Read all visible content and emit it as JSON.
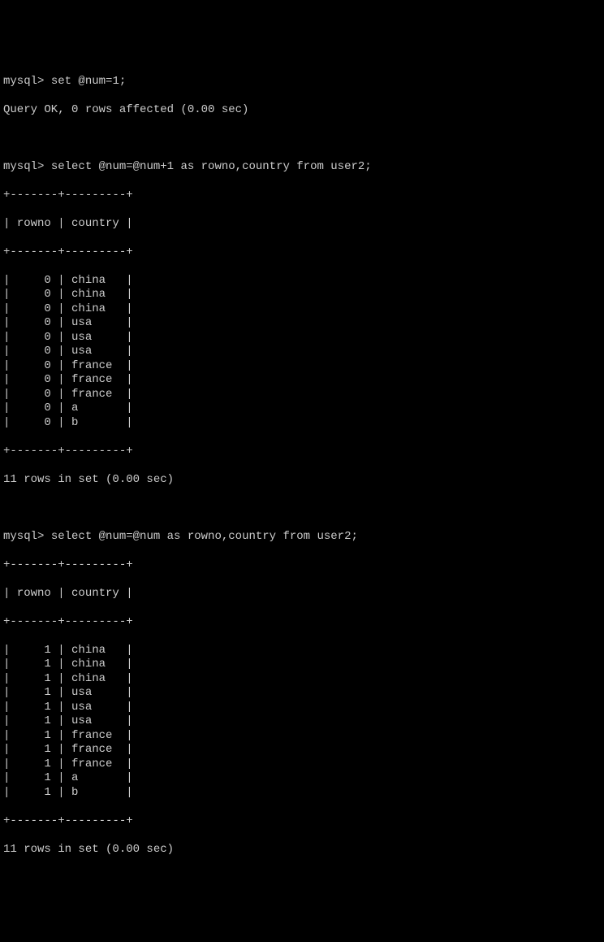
{
  "prompt": "mysql>",
  "commands": {
    "set_num": "set @num=1;",
    "set_num_result": "Query OK, 0 rows affected (0.00 sec)",
    "select1": "select @num=@num+1 as rowno,country from user2;",
    "select2": "select @num=@num as rowno,country from user2;"
  },
  "table1": {
    "border_top": "+-------+---------+",
    "header": "| rowno | country |",
    "border_mid": "+-------+---------+",
    "rows": [
      {
        "rowno": "0",
        "country": "china"
      },
      {
        "rowno": "0",
        "country": "china"
      },
      {
        "rowno": "0",
        "country": "china"
      },
      {
        "rowno": "0",
        "country": "usa"
      },
      {
        "rowno": "0",
        "country": "usa"
      },
      {
        "rowno": "0",
        "country": "usa"
      },
      {
        "rowno": "0",
        "country": "france"
      },
      {
        "rowno": "0",
        "country": "france"
      },
      {
        "rowno": "0",
        "country": "france"
      },
      {
        "rowno": "0",
        "country": "a"
      },
      {
        "rowno": "0",
        "country": "b"
      }
    ],
    "border_bot": "+-------+---------+",
    "summary": "11 rows in set (0.00 sec)"
  },
  "table2": {
    "border_top": "+-------+---------+",
    "header": "| rowno | country |",
    "border_mid": "+-------+---------+",
    "rows": [
      {
        "rowno": "1",
        "country": "china"
      },
      {
        "rowno": "1",
        "country": "china"
      },
      {
        "rowno": "1",
        "country": "china"
      },
      {
        "rowno": "1",
        "country": "usa"
      },
      {
        "rowno": "1",
        "country": "usa"
      },
      {
        "rowno": "1",
        "country": "usa"
      },
      {
        "rowno": "1",
        "country": "france"
      },
      {
        "rowno": "1",
        "country": "france"
      },
      {
        "rowno": "1",
        "country": "france"
      },
      {
        "rowno": "1",
        "country": "a"
      },
      {
        "rowno": "1",
        "country": "b"
      }
    ],
    "border_bot": "+-------+---------+",
    "summary": "11 rows in set (0.00 sec)"
  }
}
